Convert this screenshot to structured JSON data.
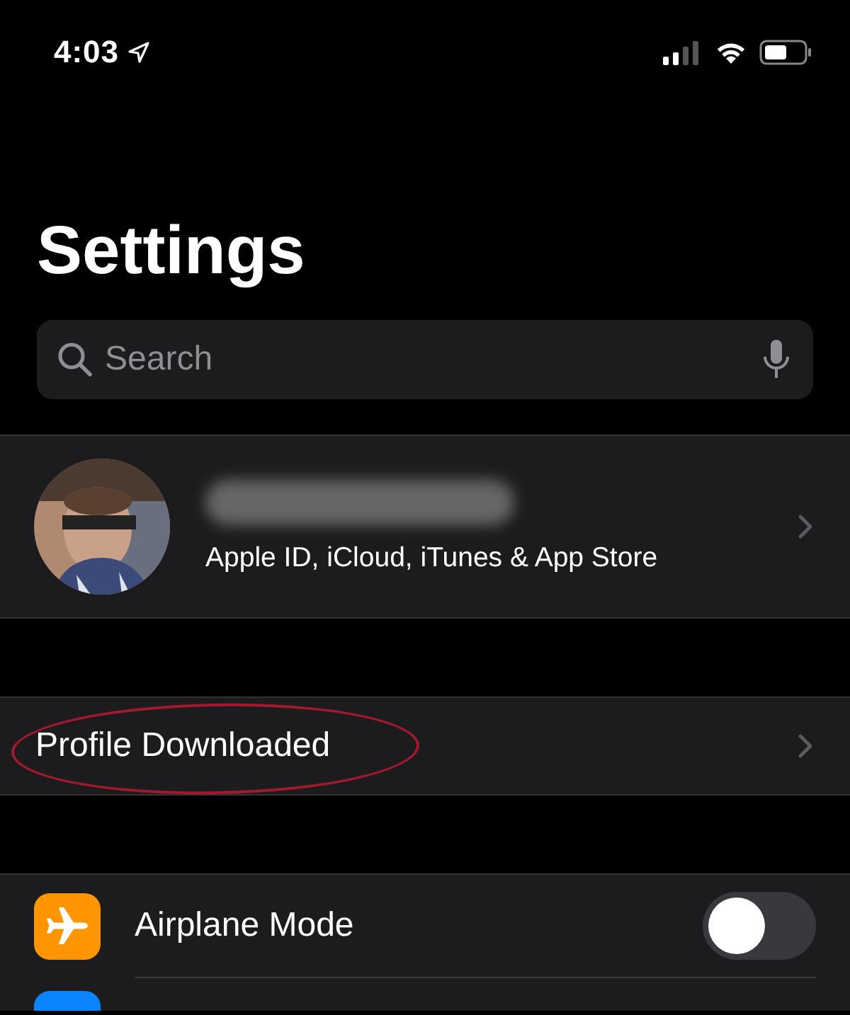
{
  "status_bar": {
    "time": "4:03",
    "location_services": true
  },
  "title": "Settings",
  "search": {
    "placeholder": "Search"
  },
  "account": {
    "subtitle": "Apple ID, iCloud, iTunes & App Store",
    "name_blurred": true
  },
  "notice": {
    "label": "Profile Downloaded",
    "circled": true
  },
  "settings": [
    {
      "kind": "toggle",
      "label": "Airplane Mode",
      "color": "#ff9500",
      "on": false
    },
    {
      "kind": "cut",
      "color": "#0a84ff"
    }
  ]
}
